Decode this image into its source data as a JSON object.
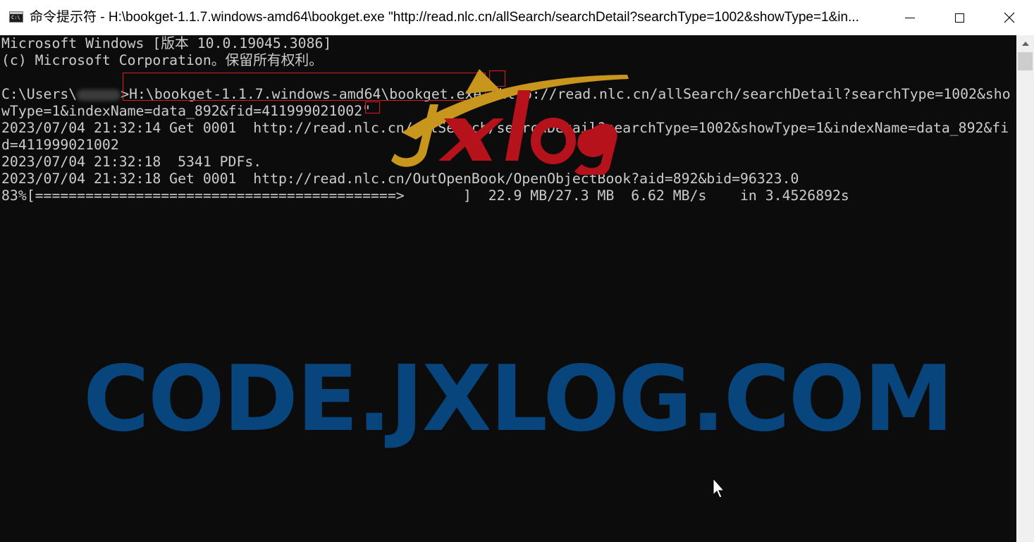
{
  "window": {
    "title": "命令提示符 - H:\\bookget-1.1.7.windows-amd64\\bookget.exe  \"http://read.nlc.cn/allSearch/searchDetail?searchType=1002&showType=1&in...",
    "icon": "cmd-icon",
    "controls": [
      "minimize-icon",
      "maximize-icon",
      "close-icon"
    ]
  },
  "console": {
    "lines": [
      "Microsoft Windows [版本 10.0.19045.3086]",
      "(c) Microsoft Corporation。保留所有权利。",
      "",
      "wType=1&indexName=data_892&fid=411999021002\"",
      "2023/07/04 21:32:14 Get 0001  http://read.nlc.cn/allSearch/searchDetail?searchType=1002&showType=1&indexName=data_892&fi",
      "d=411999021002",
      "2023/07/04 21:32:18  5341 PDFs.",
      "2023/07/04 21:32:18 Get 0001  http://read.nlc.cn/OutOpenBook/OpenObjectBook?aid=892&bid=96323.0",
      "83%[===========================================>       ]  22.9 MB/27.3 MB  6.62 MB/s    in 3.4526892s"
    ],
    "prompt_prefix": "C:\\Users\\",
    "prompt_suffix": ">",
    "command_path": "H:\\bookget-1.1.7.windows-amd64\\bookget.exe",
    "command_arg": " \"http://read.nlc.cn/allSearch/searchDetail?searchType=1002&sho"
  },
  "progress": {
    "percent": 83
  },
  "watermark": {
    "text": "CODE.JXLOG.COM",
    "logo_text": "Jxlog",
    "color": "#08457d",
    "logo_colors": [
      "#c8961c",
      "#b5121b"
    ]
  },
  "colors": {
    "console_bg": "#0c0c0c",
    "console_fg": "#cccccc",
    "highlight": "#e0191d"
  }
}
